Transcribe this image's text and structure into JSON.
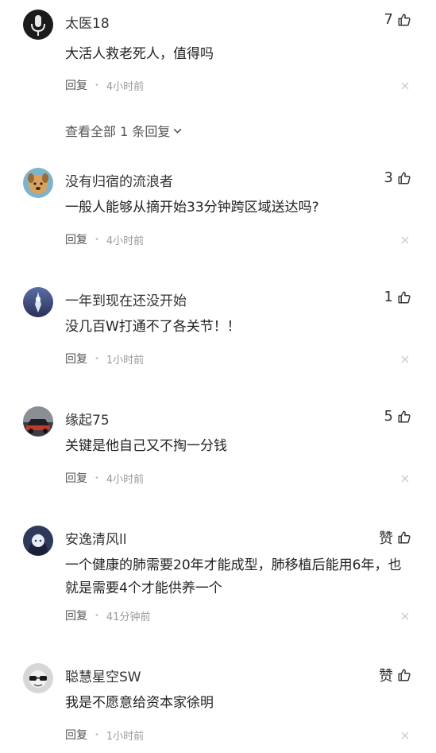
{
  "comments": [
    {
      "avatar_icon": "microphone-avatar",
      "username": "太医18",
      "text": "大活人救老死人，值得吗",
      "likes": "7",
      "reply_label": "回复",
      "time": "4小时前",
      "expand_label": "查看全部 1 条回复"
    },
    {
      "avatar_icon": "dog-avatar",
      "username": "没有归宿的流浪者",
      "text": "一般人能够从摘开始33分钟跨区域送达吗?",
      "likes": "3",
      "reply_label": "回复",
      "time": "4小时前"
    },
    {
      "avatar_icon": "tower-avatar",
      "username": "一年到现在还没开始",
      "text": "没几百W打通不了各关节！！",
      "likes": "1",
      "reply_label": "回复",
      "time": "1小时前"
    },
    {
      "avatar_icon": "car-avatar",
      "username": "缘起75",
      "text": "关键是他自己又不掏一分钱",
      "likes": "5",
      "reply_label": "回复",
      "time": "4小时前"
    },
    {
      "avatar_icon": "anime-avatar",
      "username": "安逸清风ll",
      "text": "一个健康的肺需要20年才能成型，肺移植后能用6年，也就是需要4个才能供养一个",
      "likes": "赞",
      "reply_label": "回复",
      "time": "41分钟前"
    },
    {
      "avatar_icon": "glasses-avatar",
      "username": "聪慧星空SW",
      "text": "我是不愿意给资本家徐明",
      "likes": "赞",
      "reply_label": "回复",
      "time": "1小时前"
    }
  ],
  "colors": {
    "text": "#222222",
    "muted": "#9a9a9a",
    "icon": "#333333"
  }
}
